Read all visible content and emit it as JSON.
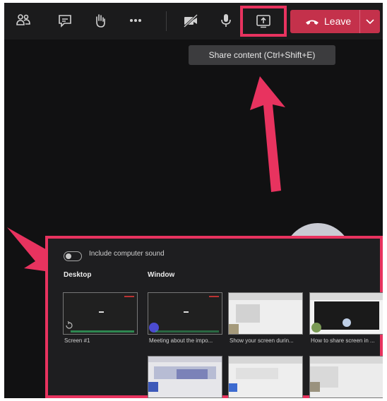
{
  "toolbar": {
    "icons": [
      "people-icon",
      "chat-icon",
      "raise-hand-icon",
      "more-icon",
      "camera-off-icon",
      "microphone-icon",
      "share-tray-icon"
    ],
    "leave_label": "Leave",
    "colors": {
      "leave": "#c4314b",
      "highlight": "#e8335f"
    }
  },
  "tooltip": {
    "text": "Share content (Ctrl+Shift+E)"
  },
  "share_tray": {
    "sound_toggle_label": "Include computer sound",
    "desktop_heading": "Desktop",
    "window_heading": "Window",
    "desktop_items": [
      {
        "label": "Screen #1"
      }
    ],
    "window_items": [
      {
        "label": "Meeting about the impo..."
      },
      {
        "label": "Show your screen durin..."
      },
      {
        "label": "How to share screen in ..."
      }
    ]
  }
}
